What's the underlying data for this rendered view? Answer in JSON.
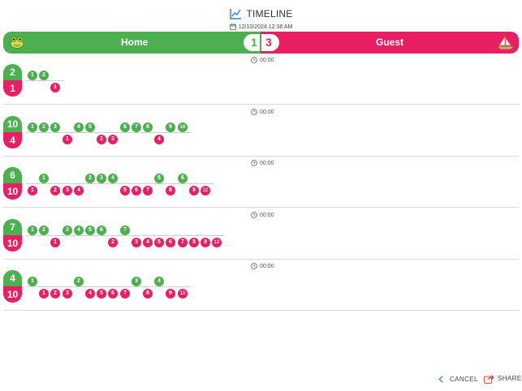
{
  "header": {
    "title": "TIMELINE",
    "title_icon": "chart-line-icon",
    "date": "12/10/2024 12:38 AM",
    "date_icon": "calendar-icon"
  },
  "scoreboard": {
    "home_label": "Home",
    "guest_label": "Guest",
    "home_score": "1",
    "guest_score": "3",
    "home_icon": "frog-icon",
    "guest_icon": "sailboat-icon",
    "home_color": "#4caf50",
    "guest_color": "#e91e63"
  },
  "periods": [
    {
      "time": "00:00",
      "home_total": "2",
      "guest_total": "1",
      "home_chips": [
        {
          "label": "1",
          "slot": 0
        },
        {
          "label": "2",
          "slot": 1
        }
      ],
      "guest_chips": [
        {
          "label": "1",
          "slot": 2
        }
      ]
    },
    {
      "time": "00:00",
      "home_total": "10",
      "guest_total": "4",
      "home_chips": [
        {
          "label": "1",
          "slot": 0
        },
        {
          "label": "2",
          "slot": 1
        },
        {
          "label": "3",
          "slot": 2
        },
        {
          "label": "4",
          "slot": 4
        },
        {
          "label": "5",
          "slot": 5
        },
        {
          "label": "6",
          "slot": 8
        },
        {
          "label": "7",
          "slot": 9
        },
        {
          "label": "8",
          "slot": 10
        },
        {
          "label": "9",
          "slot": 12
        },
        {
          "label": "10",
          "slot": 13
        }
      ],
      "guest_chips": [
        {
          "label": "1",
          "slot": 3
        },
        {
          "label": "2",
          "slot": 6
        },
        {
          "label": "3",
          "slot": 7
        },
        {
          "label": "4",
          "slot": 11
        }
      ]
    },
    {
      "time": "00:00",
      "home_total": "6",
      "guest_total": "10",
      "home_chips": [
        {
          "label": "1",
          "slot": 1
        },
        {
          "label": "2",
          "slot": 5
        },
        {
          "label": "3",
          "slot": 6
        },
        {
          "label": "4",
          "slot": 7
        },
        {
          "label": "5",
          "slot": 11
        },
        {
          "label": "6",
          "slot": 13
        }
      ],
      "guest_chips": [
        {
          "label": "1",
          "slot": 0
        },
        {
          "label": "2",
          "slot": 2
        },
        {
          "label": "3",
          "slot": 3
        },
        {
          "label": "4",
          "slot": 4
        },
        {
          "label": "5",
          "slot": 8
        },
        {
          "label": "6",
          "slot": 9
        },
        {
          "label": "7",
          "slot": 10
        },
        {
          "label": "8",
          "slot": 12
        },
        {
          "label": "9",
          "slot": 14
        },
        {
          "label": "10",
          "slot": 15
        }
      ]
    },
    {
      "time": "00:00",
      "home_total": "7",
      "guest_total": "10",
      "home_chips": [
        {
          "label": "1",
          "slot": 0
        },
        {
          "label": "2",
          "slot": 1
        },
        {
          "label": "3",
          "slot": 3
        },
        {
          "label": "4",
          "slot": 4
        },
        {
          "label": "5",
          "slot": 5
        },
        {
          "label": "6",
          "slot": 6
        },
        {
          "label": "7",
          "slot": 8
        }
      ],
      "guest_chips": [
        {
          "label": "1",
          "slot": 2
        },
        {
          "label": "2",
          "slot": 7
        },
        {
          "label": "3",
          "slot": 9
        },
        {
          "label": "4",
          "slot": 10
        },
        {
          "label": "5",
          "slot": 11
        },
        {
          "label": "6",
          "slot": 12
        },
        {
          "label": "7",
          "slot": 13
        },
        {
          "label": "8",
          "slot": 14
        },
        {
          "label": "9",
          "slot": 15
        },
        {
          "label": "10",
          "slot": 16
        }
      ]
    },
    {
      "time": "00:00",
      "home_total": "4",
      "guest_total": "10",
      "home_chips": [
        {
          "label": "1",
          "slot": 0
        },
        {
          "label": "2",
          "slot": 4
        },
        {
          "label": "3",
          "slot": 9
        },
        {
          "label": "4",
          "slot": 11
        }
      ],
      "guest_chips": [
        {
          "label": "1",
          "slot": 1
        },
        {
          "label": "2",
          "slot": 2
        },
        {
          "label": "3",
          "slot": 3
        },
        {
          "label": "4",
          "slot": 5
        },
        {
          "label": "5",
          "slot": 6
        },
        {
          "label": "6",
          "slot": 7
        },
        {
          "label": "7",
          "slot": 8
        },
        {
          "label": "8",
          "slot": 10
        },
        {
          "label": "9",
          "slot": 12
        },
        {
          "label": "10",
          "slot": 13
        }
      ]
    }
  ],
  "footer": {
    "cancel_label": "CANCEL",
    "cancel_icon": "chevron-left-icon",
    "share_label": "SHARE",
    "share_icon": "share-icon"
  }
}
